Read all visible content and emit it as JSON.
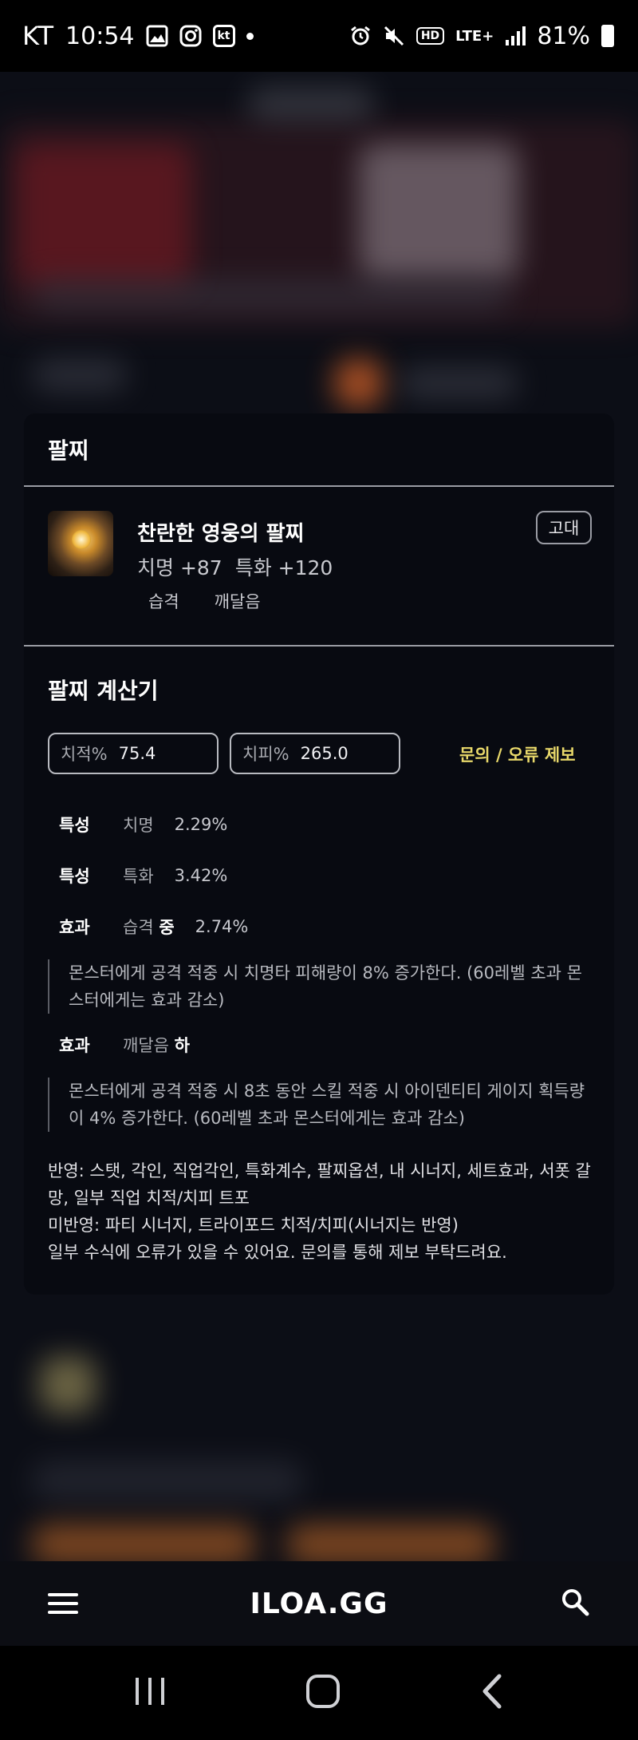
{
  "status_bar": {
    "carrier": "KT",
    "time": "10:54",
    "kt_badge": "kt",
    "hd": "HD",
    "network": "LTE+",
    "battery": "81%"
  },
  "modal": {
    "title": "팔찌",
    "item": {
      "name": "찬란한 영웅의 팔찌",
      "stats": [
        "치명 +87",
        "특화 +120"
      ],
      "tags": [
        "습격",
        "깨달음"
      ],
      "grade": "고대"
    },
    "calculator": {
      "title": "팔찌 계산기",
      "fields": [
        {
          "label": "치적%",
          "value": "75.4"
        },
        {
          "label": "치피%",
          "value": "265.0"
        }
      ],
      "report_link": "문의 / 오류 제보",
      "rows": [
        {
          "label": "특성",
          "name": "치명",
          "name_bold": "",
          "value": "2.29%"
        },
        {
          "label": "특성",
          "name": "특화",
          "name_bold": "",
          "value": "3.42%"
        },
        {
          "label": "효과",
          "name": "습격",
          "name_bold": "중",
          "value": "2.74%"
        },
        {
          "label": "효과",
          "name": "깨달음",
          "name_bold": "하",
          "value": ""
        }
      ],
      "descriptions": [
        "몬스터에게 공격 적중 시 치명타 피해량이 8% 증가한다. (60레벨 초과 몬스터에게는 효과 감소)",
        "몬스터에게 공격 적중 시 8초 동안 스킬 적중 시 아이덴티티 게이지 획득량이 4% 증가한다. (60레벨 초과 몬스터에게는 효과 감소)"
      ],
      "notes": [
        "반영: 스탯, 각인, 직업각인, 특화계수, 팔찌옵션, 내 시너지, 세트효과, 서폿 갈망, 일부 직업 치적/치피 트포",
        "미반영: 파티 시너지, 트라이포드 치적/치피(시너지는 반영)",
        "일부 수식에 오류가 있을 수 있어요. 문의를 통해 제보 부탁드려요."
      ]
    }
  },
  "app_bar": {
    "logo": "ILOA.GG",
    "menu_icon": "hamburger-menu-icon",
    "search_icon": "search-icon"
  },
  "nav_bar": {
    "icons": [
      "recent-apps-icon",
      "home-icon",
      "back-icon"
    ]
  }
}
